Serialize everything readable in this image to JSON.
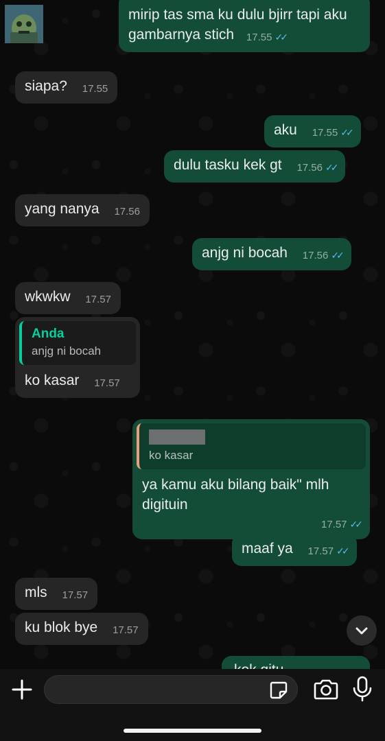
{
  "messages": [
    {
      "dir": "out",
      "text": "mirip tas sma ku dulu bjirr tapi aku gambarnya stich",
      "time": "17.55",
      "ticks": "✓✓"
    },
    {
      "dir": "in",
      "text": "siapa?",
      "time": "17.55"
    },
    {
      "dir": "out",
      "text": "aku",
      "time": "17.55",
      "ticks": "✓✓"
    },
    {
      "dir": "out",
      "text": "dulu tasku kek gt",
      "time": "17.56",
      "ticks": "✓✓"
    },
    {
      "dir": "in",
      "text": "yang nanya",
      "time": "17.56"
    },
    {
      "dir": "out",
      "text": "anjg ni bocah",
      "time": "17.56",
      "ticks": "✓✓"
    },
    {
      "dir": "in",
      "text": "wkwkw",
      "time": "17.57"
    },
    {
      "dir": "in",
      "text": "ko kasar",
      "time": "17.57",
      "quote": {
        "author": "Anda",
        "text": "anjg ni bocah"
      }
    },
    {
      "dir": "out",
      "text": "ya kamu aku bilang baik\" mlh digituin",
      "time": "17.57",
      "ticks": "✓✓",
      "quote": {
        "text": "ko kasar"
      }
    },
    {
      "dir": "out",
      "text": "maaf ya",
      "time": "17.57",
      "ticks": "✓✓"
    },
    {
      "dir": "in",
      "text": "mls",
      "time": "17.57"
    },
    {
      "dir": "in",
      "text": "ku blok bye",
      "time": "17.57"
    },
    {
      "dir": "out",
      "text": "kok gitu",
      "time": "",
      "ticks": ""
    }
  ],
  "icons": {
    "scroll": "chevron-down-icon",
    "plus": "plus-icon",
    "sticker": "sticker-icon",
    "camera": "camera-icon",
    "mic": "microphone-icon"
  },
  "colors": {
    "incoming": "#262626",
    "outgoing": "#144d37",
    "read_ticks": "#53bdeb",
    "quote_author": "#06cf9c"
  }
}
